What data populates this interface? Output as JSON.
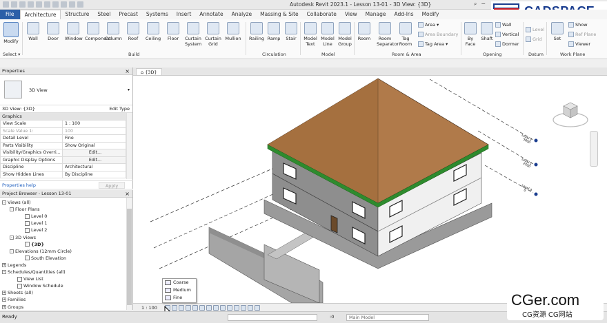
{
  "window": {
    "title": "Autodesk Revit 2023.1 - Lesson 13-01 - 3D View: {3D}"
  },
  "logo": {
    "text": "CADSPACE",
    "colors": {
      "red": "#d31f26",
      "blue": "#1a3d8f"
    }
  },
  "tabs": [
    "File",
    "Architecture",
    "Structure",
    "Steel",
    "Precast",
    "Systems",
    "Insert",
    "Annotate",
    "Analyze",
    "Massing & Site",
    "Collaborate",
    "View",
    "Manage",
    "Add-Ins",
    "Modify"
  ],
  "active_tab": "Architecture",
  "ribbon": {
    "modify": "Modify",
    "select": "Select",
    "build": {
      "label": "Build",
      "tools": [
        "Wall",
        "Door",
        "Window",
        "Component",
        "Column",
        "Roof",
        "Ceiling",
        "Floor",
        "Curtain System",
        "Curtain Grid",
        "Mullion"
      ]
    },
    "circulation": {
      "label": "Circulation",
      "tools": [
        "Railing",
        "Ramp",
        "Stair"
      ]
    },
    "model": {
      "label": "Model",
      "tools": [
        "Model Text",
        "Model Line",
        "Model Group"
      ]
    },
    "room_area": {
      "label": "Room & Area",
      "tools": [
        "Room",
        "Room Separator",
        "Tag Room"
      ],
      "small": [
        "Area",
        "Area Boundary",
        "Tag Area"
      ]
    },
    "opening": {
      "label": "Opening",
      "tools": [
        "By Face",
        "Shaft"
      ],
      "small": [
        "Wall",
        "Vertical",
        "Dormer"
      ]
    },
    "datum": {
      "label": "Datum",
      "small": [
        "Level",
        "Grid"
      ]
    },
    "work_plane": {
      "label": "Work Plane",
      "tools": [
        "Set"
      ],
      "small": [
        "Show",
        "Ref Plane",
        "Viewer"
      ]
    }
  },
  "properties": {
    "header": "Properties",
    "type_name": "3D View",
    "selector": "3D View: {3D}",
    "edit_type": "Edit Type",
    "group": "Graphics",
    "rows": [
      {
        "label": "View Scale",
        "value": "1 : 100",
        "dim": false
      },
      {
        "label": "Scale Value    1:",
        "value": "100",
        "dim": true
      },
      {
        "label": "Detail Level",
        "value": "Fine",
        "dim": false
      },
      {
        "label": "Parts Visibility",
        "value": "Show Original",
        "dim": false
      },
      {
        "label": "Visibility/Graphics Overri...",
        "value": "Edit...",
        "dim": false,
        "button": true
      },
      {
        "label": "Graphic Display Options",
        "value": "Edit...",
        "dim": false,
        "button": true
      },
      {
        "label": "Discipline",
        "value": "Architectural",
        "dim": false
      },
      {
        "label": "Show Hidden Lines",
        "value": "By Discipline",
        "dim": false
      }
    ],
    "help_link": "Properties help",
    "apply": "Apply"
  },
  "project_browser": {
    "header": "Project Browser - Lesson 13-01",
    "nodes": [
      {
        "text": "Views (all)",
        "indent": 0,
        "toggle": "-"
      },
      {
        "text": "Floor Plans",
        "indent": 1,
        "toggle": "-"
      },
      {
        "text": "Level 0",
        "indent": 3,
        "toggle": ""
      },
      {
        "text": "Level 1",
        "indent": 3,
        "toggle": ""
      },
      {
        "text": "Level 2",
        "indent": 3,
        "toggle": ""
      },
      {
        "text": "3D Views",
        "indent": 1,
        "toggle": "-"
      },
      {
        "text": "{3D}",
        "indent": 3,
        "toggle": "",
        "bold": true
      },
      {
        "text": "Elevations (12mm Circle)",
        "indent": 1,
        "toggle": "-"
      },
      {
        "text": "South Elevation",
        "indent": 3,
        "toggle": ""
      },
      {
        "text": "Legends",
        "indent": 0,
        "toggle": "+"
      },
      {
        "text": "Schedules/Quantities (all)",
        "indent": 0,
        "toggle": "-"
      },
      {
        "text": "View List",
        "indent": 2,
        "toggle": ""
      },
      {
        "text": "Window Schedule",
        "indent": 2,
        "toggle": ""
      },
      {
        "text": "Sheets (all)",
        "indent": 0,
        "toggle": "+"
      },
      {
        "text": "Families",
        "indent": 0,
        "toggle": "+"
      },
      {
        "text": "Groups",
        "indent": 0,
        "toggle": "+"
      }
    ]
  },
  "view_tab": "{3D}",
  "levels": [
    {
      "name": "Level 2",
      "elevation": "5000"
    },
    {
      "name": "Level 1",
      "elevation": "2500"
    },
    {
      "name": "Level 0",
      "elevation": "0"
    }
  ],
  "view_control": {
    "scale": "1 : 100"
  },
  "detail_levels": [
    "Coarse",
    "Medium",
    "Fine"
  ],
  "status": {
    "ready": "Ready",
    "zero": ":0",
    "model": "Main Model"
  },
  "watermark": {
    "big": "CGer.com",
    "small": "CG资源  CG网站"
  },
  "colors": {
    "roof": "#b07a4a",
    "roof_edge": "#2e8b2e",
    "wall_light": "#f0f0f0",
    "wall_dark": "#8c8c8c",
    "slab": "#a8a8a8",
    "file_tab": "#2b5fa8"
  }
}
